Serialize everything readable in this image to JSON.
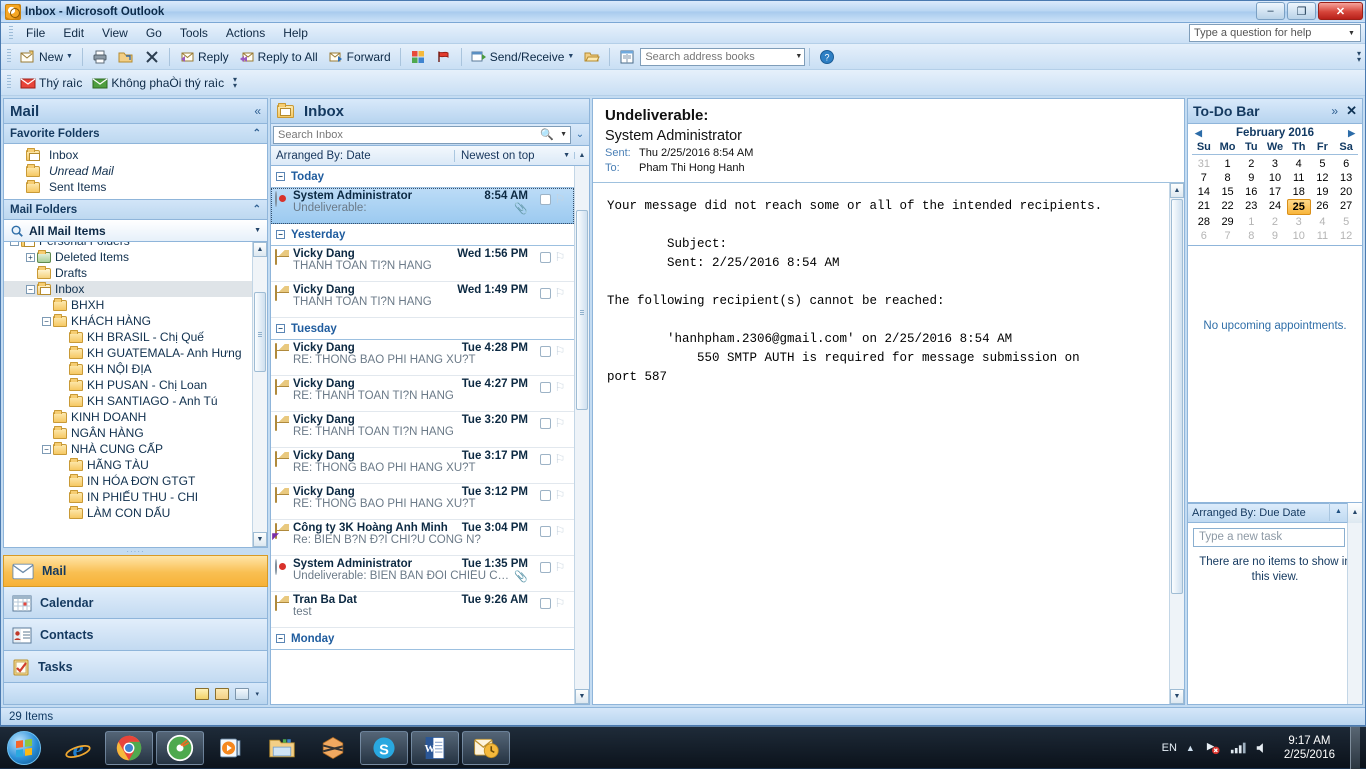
{
  "window": {
    "title": "Inbox - Microsoft Outlook",
    "app_icon": "outlook-icon",
    "minimize": "–",
    "restore": "❐",
    "close": "✕"
  },
  "menubar": {
    "items": [
      "File",
      "Edit",
      "View",
      "Go",
      "Tools",
      "Actions",
      "Help"
    ]
  },
  "help_box": {
    "placeholder": "Type a question for help"
  },
  "toolbar": {
    "new_label": "New",
    "print_icon": "print-icon",
    "move_icon": "move-to-folder-icon",
    "delete_icon": "delete-icon",
    "reply_label": "Reply",
    "reply_all_label": "Reply to All",
    "forward_label": "Forward",
    "categorize_icon": "categorize-icon",
    "followup_icon": "follow-up-flag-icon",
    "send_receive_label": "Send/Receive",
    "open_icon": "open-folder-icon",
    "address_book_icon": "address-book-icon",
    "address_search_placeholder": "Search address books",
    "help_icon": "help-icon"
  },
  "toolbar2": {
    "junk_label": "Thý raìc",
    "not_junk_label": "Không phaÒi thý raìc"
  },
  "navpane": {
    "title": "Mail",
    "collapse_icon": "chevron-double-left-icon",
    "favorite_folders": {
      "title": "Favorite Folders",
      "items": [
        {
          "label": "Inbox",
          "icon": "inbox-folder-icon",
          "italic": false
        },
        {
          "label": "Unread Mail",
          "icon": "search-folder-icon",
          "italic": true
        },
        {
          "label": "Sent Items",
          "icon": "sent-folder-icon",
          "italic": false
        }
      ]
    },
    "mail_folders": {
      "title": "Mail Folders",
      "all_mail_label": "All Mail Items",
      "tree": [
        {
          "label": "Personal Folders",
          "indent": 0,
          "toggle": "minus",
          "icon": "personal-folders-icon",
          "selected": false
        },
        {
          "label": "Deleted Items",
          "indent": 1,
          "toggle": "plus",
          "icon": "trash-icon",
          "selected": false
        },
        {
          "label": "Drafts",
          "indent": 1,
          "toggle": "",
          "icon": "drafts-icon",
          "selected": false
        },
        {
          "label": "Inbox",
          "indent": 1,
          "toggle": "minus",
          "icon": "inbox-folder-icon",
          "selected": true
        },
        {
          "label": "BHXH",
          "indent": 2,
          "toggle": "",
          "icon": "folder-icon",
          "selected": false
        },
        {
          "label": "KHÁCH HÀNG",
          "indent": 2,
          "toggle": "minus",
          "icon": "folder-icon",
          "selected": false
        },
        {
          "label": "KH BRASIL - Chị Quế",
          "indent": 3,
          "toggle": "",
          "icon": "folder-icon",
          "selected": false
        },
        {
          "label": "KH GUATEMALA- Anh Hưng",
          "indent": 3,
          "toggle": "",
          "icon": "folder-icon",
          "selected": false
        },
        {
          "label": "KH NỘI ĐỊA",
          "indent": 3,
          "toggle": "",
          "icon": "folder-icon",
          "selected": false
        },
        {
          "label": "KH PUSAN - Chị Loan",
          "indent": 3,
          "toggle": "",
          "icon": "folder-icon",
          "selected": false
        },
        {
          "label": "KH SANTIAGO - Anh Tú",
          "indent": 3,
          "toggle": "",
          "icon": "folder-icon",
          "selected": false
        },
        {
          "label": "KINH DOANH",
          "indent": 2,
          "toggle": "",
          "icon": "folder-icon",
          "selected": false
        },
        {
          "label": "NGÂN HÀNG",
          "indent": 2,
          "toggle": "",
          "icon": "folder-icon",
          "selected": false
        },
        {
          "label": "NHÀ CUNG CẤP",
          "indent": 2,
          "toggle": "minus",
          "icon": "folder-icon",
          "selected": false
        },
        {
          "label": "HÃNG TÀU",
          "indent": 3,
          "toggle": "",
          "icon": "folder-icon",
          "selected": false
        },
        {
          "label": "IN HÓA ĐƠN GTGT",
          "indent": 3,
          "toggle": "",
          "icon": "folder-icon",
          "selected": false
        },
        {
          "label": "IN PHIẾU THU - CHI",
          "indent": 3,
          "toggle": "",
          "icon": "folder-icon",
          "selected": false
        },
        {
          "label": "LÀM CON DẤU",
          "indent": 3,
          "toggle": "",
          "icon": "folder-icon",
          "selected": false
        }
      ]
    },
    "modules": [
      {
        "label": "Mail",
        "icon": "mail-icon",
        "active": true
      },
      {
        "label": "Calendar",
        "icon": "calendar-icon",
        "active": false
      },
      {
        "label": "Contacts",
        "icon": "contacts-icon",
        "active": false
      },
      {
        "label": "Tasks",
        "icon": "tasks-icon",
        "active": false
      }
    ],
    "footer_icons": [
      "notes-icon",
      "folder-list-icon",
      "shortcuts-icon",
      "configure-buttons-icon"
    ]
  },
  "listpane": {
    "title": "Inbox",
    "title_icon": "inbox-folder-icon",
    "search_placeholder": "Search Inbox",
    "search_icon": "search-icon",
    "expand_query_icon": "chevron-double-down-icon",
    "arranged_by": "Arranged By: Date",
    "sort_order": "Newest on top",
    "groups": [
      {
        "name": "Today",
        "messages": [
          {
            "from": "System Administrator",
            "subject": "Undeliverable:",
            "time": "8:54 AM",
            "icon": "undeliverable-icon",
            "attachment": true,
            "selected": true
          }
        ]
      },
      {
        "name": "Yesterday",
        "messages": [
          {
            "from": "Vicky Dang",
            "subject": "THANH TOÁN TI?N HÀNG",
            "time": "Wed 1:56 PM",
            "icon": "mail-unopened-icon",
            "attachment": false,
            "selected": false
          },
          {
            "from": "Vicky Dang",
            "subject": "THANH TOÁN TI?N HÀNG",
            "time": "Wed 1:49 PM",
            "icon": "mail-unopened-icon",
            "attachment": false,
            "selected": false
          }
        ]
      },
      {
        "name": "Tuesday",
        "messages": [
          {
            "from": "Vicky Dang",
            "subject": "RE: THÔNG BÁO PHÍ HÀNG XU?T",
            "time": "Tue 4:28 PM",
            "icon": "mail-unopened-icon",
            "attachment": false,
            "selected": false
          },
          {
            "from": "Vicky Dang",
            "subject": "RE: THANH TOÁN TI?N HÀNG",
            "time": "Tue 4:27 PM",
            "icon": "mail-unopened-icon",
            "attachment": false,
            "selected": false
          },
          {
            "from": "Vicky Dang",
            "subject": "RE: THANH TOÁN TI?N HÀNG",
            "time": "Tue 3:20 PM",
            "icon": "mail-unopened-icon",
            "attachment": false,
            "selected": false
          },
          {
            "from": "Vicky Dang",
            "subject": "RE: THÔNG BÁO PHÍ HÀNG XU?T",
            "time": "Tue 3:17 PM",
            "icon": "mail-unopened-icon",
            "attachment": false,
            "selected": false
          },
          {
            "from": "Vicky Dang",
            "subject": "RE: THÔNG BÁO PHÍ HÀNG XU?T",
            "time": "Tue 3:12 PM",
            "icon": "mail-unopened-icon",
            "attachment": false,
            "selected": false
          },
          {
            "from": "Công ty 3K Hoàng Anh Minh",
            "subject": "Re: BIÊN B?N Đ?I CHI?U CÔNG N?",
            "time": "Tue 3:04 PM",
            "icon": "mail-replied-icon",
            "attachment": false,
            "selected": false
          },
          {
            "from": "System Administrator",
            "subject": "Undeliverable: BIÊN BẢN ĐỐI CHIẾU CÔ…",
            "time": "Tue 1:35 PM",
            "icon": "undeliverable-icon",
            "attachment": true,
            "selected": false
          },
          {
            "from": "Tran Ba Dat",
            "subject": "test",
            "time": "Tue 9:26 AM",
            "icon": "mail-unopened-icon",
            "attachment": false,
            "selected": false
          }
        ]
      },
      {
        "name": "Monday",
        "messages": []
      }
    ]
  },
  "reading_pane": {
    "subject": "Undeliverable:",
    "sender": "System Administrator",
    "sent_label": "Sent:",
    "sent_value": "Thu 2/25/2016 8:54 AM",
    "to_label": "To:",
    "to_value": "Pham Thi Hong Hanh",
    "body": "Your message did not reach some or all of the intended recipients.\n\n        Subject:\n        Sent: 2/25/2016 8:54 AM\n\nThe following recipient(s) cannot be reached:\n\n        'hanhpham.2306@gmail.com' on 2/25/2016 8:54 AM\n            550 SMTP AUTH is required for message submission on\nport 587"
  },
  "todo_bar": {
    "title": "To-Do Bar",
    "expand_icon": "chevron-double-right-icon",
    "close_icon": "close-icon",
    "calendar": {
      "month_label": "February 2016",
      "prev_icon": "triangle-left-icon",
      "next_icon": "triangle-right-icon",
      "day_headers": [
        "Su",
        "Mo",
        "Tu",
        "We",
        "Th",
        "Fr",
        "Sa"
      ],
      "weeks": [
        [
          {
            "d": "31",
            "o": true
          },
          {
            "d": "1"
          },
          {
            "d": "2"
          },
          {
            "d": "3"
          },
          {
            "d": "4"
          },
          {
            "d": "5"
          },
          {
            "d": "6"
          }
        ],
        [
          {
            "d": "7"
          },
          {
            "d": "8"
          },
          {
            "d": "9"
          },
          {
            "d": "10"
          },
          {
            "d": "11"
          },
          {
            "d": "12"
          },
          {
            "d": "13"
          }
        ],
        [
          {
            "d": "14"
          },
          {
            "d": "15"
          },
          {
            "d": "16"
          },
          {
            "d": "17"
          },
          {
            "d": "18"
          },
          {
            "d": "19"
          },
          {
            "d": "20"
          }
        ],
        [
          {
            "d": "21"
          },
          {
            "d": "22"
          },
          {
            "d": "23"
          },
          {
            "d": "24"
          },
          {
            "d": "25",
            "today": true
          },
          {
            "d": "26"
          },
          {
            "d": "27"
          }
        ],
        [
          {
            "d": "28"
          },
          {
            "d": "29"
          },
          {
            "d": "1",
            "o": true
          },
          {
            "d": "2",
            "o": true
          },
          {
            "d": "3",
            "o": true
          },
          {
            "d": "4",
            "o": true
          },
          {
            "d": "5",
            "o": true
          }
        ],
        [
          {
            "d": "6",
            "o": true
          },
          {
            "d": "7",
            "o": true
          },
          {
            "d": "8",
            "o": true
          },
          {
            "d": "9",
            "o": true
          },
          {
            "d": "10",
            "o": true
          },
          {
            "d": "11",
            "o": true
          },
          {
            "d": "12",
            "o": true
          }
        ]
      ]
    },
    "appointments_empty": "No upcoming appointments.",
    "tasks": {
      "arranged_by": "Arranged By: Due Date",
      "sort_icon": "sort-ascending-icon",
      "new_task_placeholder": "Type a new task",
      "empty_text": "There are no items to show in this view."
    }
  },
  "status_bar": {
    "text": "29 Items"
  },
  "taskbar": {
    "start_icon": "windows-start-icon",
    "apps": [
      {
        "icon": "internet-explorer-icon",
        "pinned": false
      },
      {
        "icon": "google-chrome-icon",
        "pinned": true
      },
      {
        "icon": "nero-icon",
        "pinned": true
      },
      {
        "icon": "media-player-icon",
        "pinned": false
      },
      {
        "icon": "file-explorer-icon",
        "pinned": false
      },
      {
        "icon": "unikey-icon",
        "pinned": false
      },
      {
        "icon": "skype-icon",
        "pinned": true
      },
      {
        "icon": "word-icon",
        "pinned": true
      },
      {
        "icon": "outlook-icon",
        "pinned": true
      }
    ],
    "tray": {
      "language": "EN",
      "show_hidden_icon": "chevron-up-icon",
      "network_icon": "network-error-icon",
      "volume_icon": "volume-icon",
      "signal_icon": "signal-icon",
      "time": "9:17 AM",
      "date": "2/25/2016"
    }
  },
  "colors": {
    "accent": "#f7b136",
    "selection": "#9ccaf0",
    "header_blue": "#14395f",
    "link_blue": "#2f6ea8",
    "today_highlight": "#f8b53c"
  }
}
